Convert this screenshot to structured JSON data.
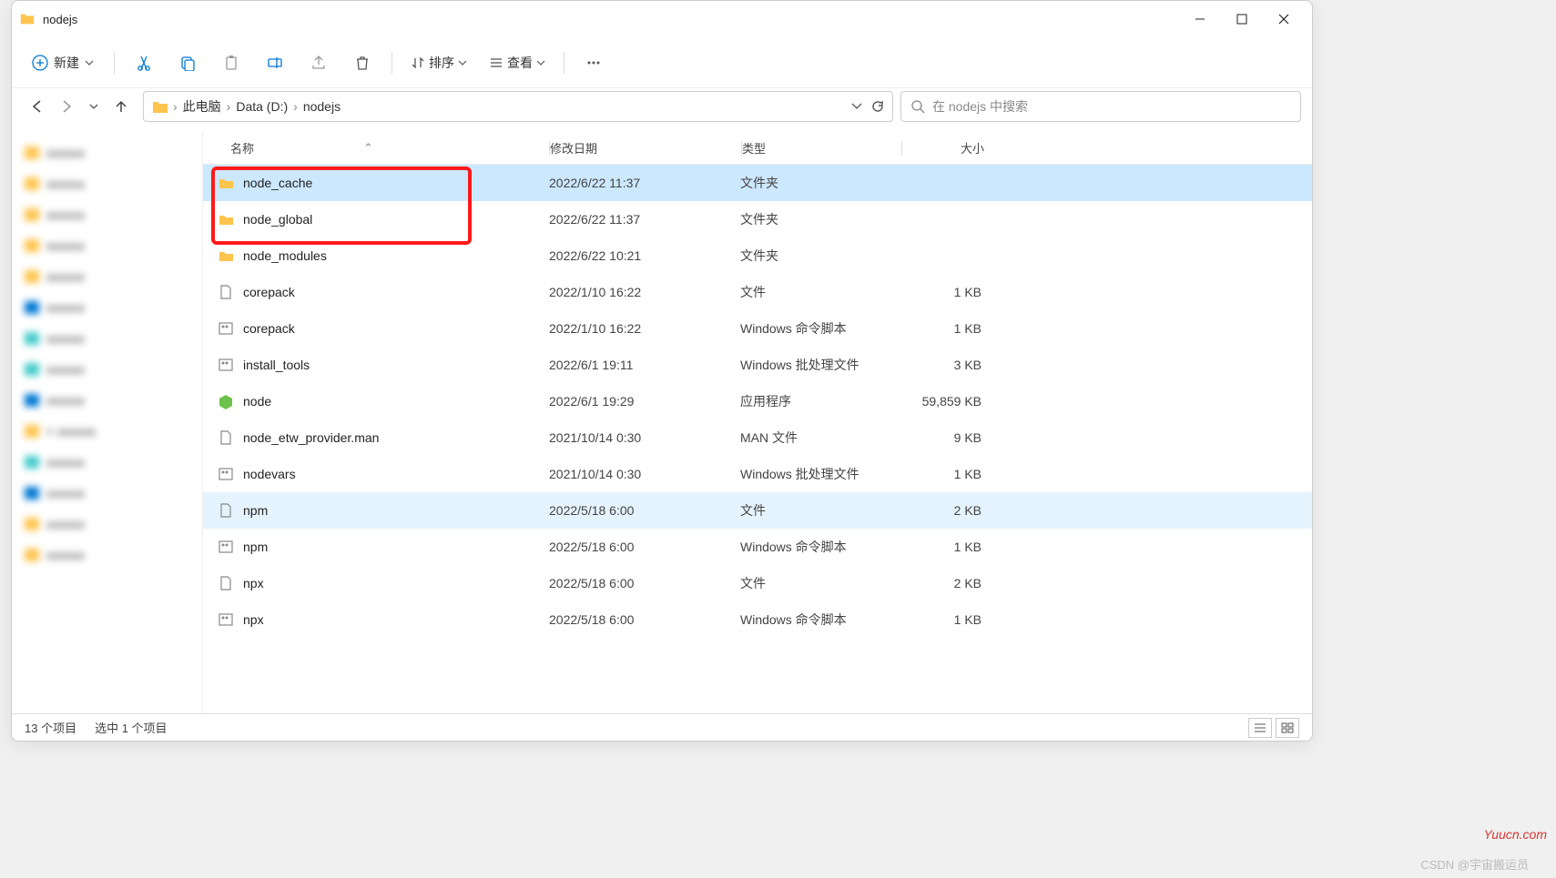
{
  "titlebar": {
    "title": "nodejs"
  },
  "toolbar": {
    "new_label": "新建",
    "sort_label": "排序",
    "view_label": "查看"
  },
  "nav": {
    "breadcrumbs": [
      "此电脑",
      "Data (D:)",
      "nodejs"
    ]
  },
  "search": {
    "placeholder": "在 nodejs 中搜索"
  },
  "columns": {
    "name": "名称",
    "modified": "修改日期",
    "type": "类型",
    "size": "大小"
  },
  "rows": [
    {
      "icon": "folder",
      "name": "node_cache",
      "modified": "2022/6/22 11:37",
      "type": "文件夹",
      "size": "",
      "selected": true
    },
    {
      "icon": "folder",
      "name": "node_global",
      "modified": "2022/6/22 11:37",
      "type": "文件夹",
      "size": ""
    },
    {
      "icon": "folder",
      "name": "node_modules",
      "modified": "2022/6/22 10:21",
      "type": "文件夹",
      "size": ""
    },
    {
      "icon": "file",
      "name": "corepack",
      "modified": "2022/1/10 16:22",
      "type": "文件",
      "size": "1 KB"
    },
    {
      "icon": "cmd",
      "name": "corepack",
      "modified": "2022/1/10 16:22",
      "type": "Windows 命令脚本",
      "size": "1 KB"
    },
    {
      "icon": "cmd",
      "name": "install_tools",
      "modified": "2022/6/1 19:11",
      "type": "Windows 批处理文件",
      "size": "3 KB"
    },
    {
      "icon": "node",
      "name": "node",
      "modified": "2022/6/1 19:29",
      "type": "应用程序",
      "size": "59,859 KB"
    },
    {
      "icon": "file",
      "name": "node_etw_provider.man",
      "modified": "2021/10/14 0:30",
      "type": "MAN 文件",
      "size": "9 KB"
    },
    {
      "icon": "cmd",
      "name": "nodevars",
      "modified": "2021/10/14 0:30",
      "type": "Windows 批处理文件",
      "size": "1 KB"
    },
    {
      "icon": "file",
      "name": "npm",
      "modified": "2022/5/18 6:00",
      "type": "文件",
      "size": "2 KB",
      "hover": true
    },
    {
      "icon": "cmd",
      "name": "npm",
      "modified": "2022/5/18 6:00",
      "type": "Windows 命令脚本",
      "size": "1 KB"
    },
    {
      "icon": "file",
      "name": "npx",
      "modified": "2022/5/18 6:00",
      "type": "文件",
      "size": "2 KB"
    },
    {
      "icon": "cmd",
      "name": "npx",
      "modified": "2022/5/18 6:00",
      "type": "Windows 命令脚本",
      "size": "1 KB"
    }
  ],
  "status": {
    "count": "13 个项目",
    "selection": "选中 1 个项目"
  },
  "watermarks": {
    "yuucn": "Yuucn.com",
    "csdn": "CSDN @宇宙搬运员"
  }
}
